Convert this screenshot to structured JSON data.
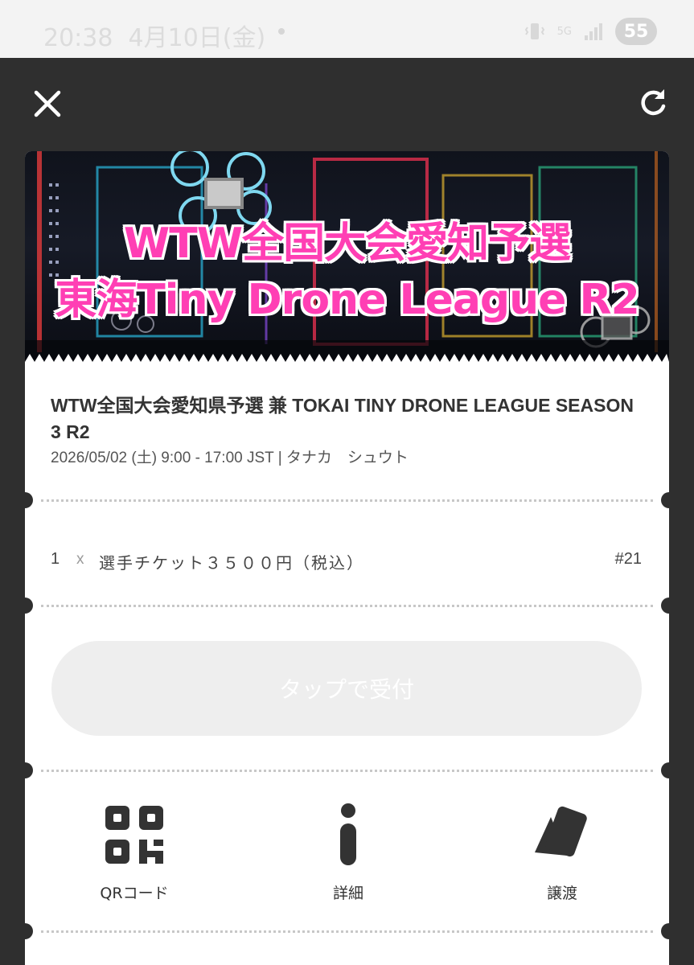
{
  "status_bar": {
    "time": "20:38",
    "date": "4月10日(金)",
    "battery": "55",
    "network": "5G"
  },
  "top_bar": {
    "close_icon": "close-icon",
    "reload_icon": "reload-icon"
  },
  "banner": {
    "line1": "WTW全国大会愛知予選",
    "line2": "東海Tiny Drone League R2"
  },
  "event": {
    "title": "WTW全国大会愛知県予選 兼 TOKAI TINY DRONE LEAGUE SEASON 3 R2",
    "meta": "2026/05/02 (土) 9:00 - 17:00 JST | タナカ　シュウト"
  },
  "ticket": {
    "quantity": "1",
    "times": "x",
    "name": "選手チケット３５００円（税込）",
    "number": "#21"
  },
  "checkin": {
    "label": "タップで受付"
  },
  "actions": [
    {
      "label": "QRコード",
      "icon": "qr-code-icon"
    },
    {
      "label": "詳細",
      "icon": "info-icon"
    },
    {
      "label": "譲渡",
      "icon": "transfer-ticket-icon"
    }
  ],
  "colors": {
    "background": "#2f2f2f",
    "card": "#ffffff",
    "banner_text": "#ff3fb4",
    "button_disabled": "#eeeeee"
  }
}
